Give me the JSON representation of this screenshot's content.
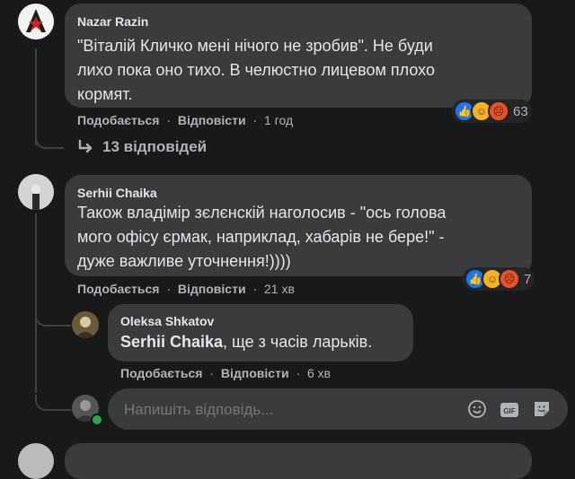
{
  "comments": [
    {
      "author": "Nazar Razin",
      "text_lines": [
        "\"Віталій Кличко мені нічого не зробив\". Не буди",
        "лихо пока оно тихо. В челюстно лицевом плохо",
        "кормят."
      ],
      "like_label": "Подобається",
      "reply_label": "Відповісти",
      "time": "1 год",
      "reaction_count": "63",
      "replies_link": "13 відповідей"
    },
    {
      "author": "Serhii Chaika",
      "text_lines": [
        "Також владімір зєлєнскій наголосив - \"ось голова",
        "мого офісу єрмак, наприклад, хабарів не бере!\" -",
        "дуже важливе уточнення!))))"
      ],
      "like_label": "Подобається",
      "reply_label": "Відповісти",
      "time": "21 хв",
      "reaction_count": "7"
    }
  ],
  "reply": {
    "author": "Oleksa Shkatov",
    "mention": "Serhii Chaika",
    "text": ", ще з часів ларьків.",
    "like_label": "Подобається",
    "reply_label": "Відповісти",
    "time": "6 хв"
  },
  "composer": {
    "placeholder": "Напишіть відповідь..."
  },
  "separator": "·",
  "icons": {
    "replies_arrow": "reply-arrow-icon",
    "emoji": "emoji-icon",
    "gif": "gif-icon",
    "sticker": "sticker-icon"
  },
  "colors": {
    "background": "#18191a",
    "bubble": "#3a3b3c",
    "text": "#e4e6eb",
    "secondary": "#b0b3b8",
    "like": "#1877f2",
    "haha": "#f7b125",
    "angry": "#e4512b"
  }
}
